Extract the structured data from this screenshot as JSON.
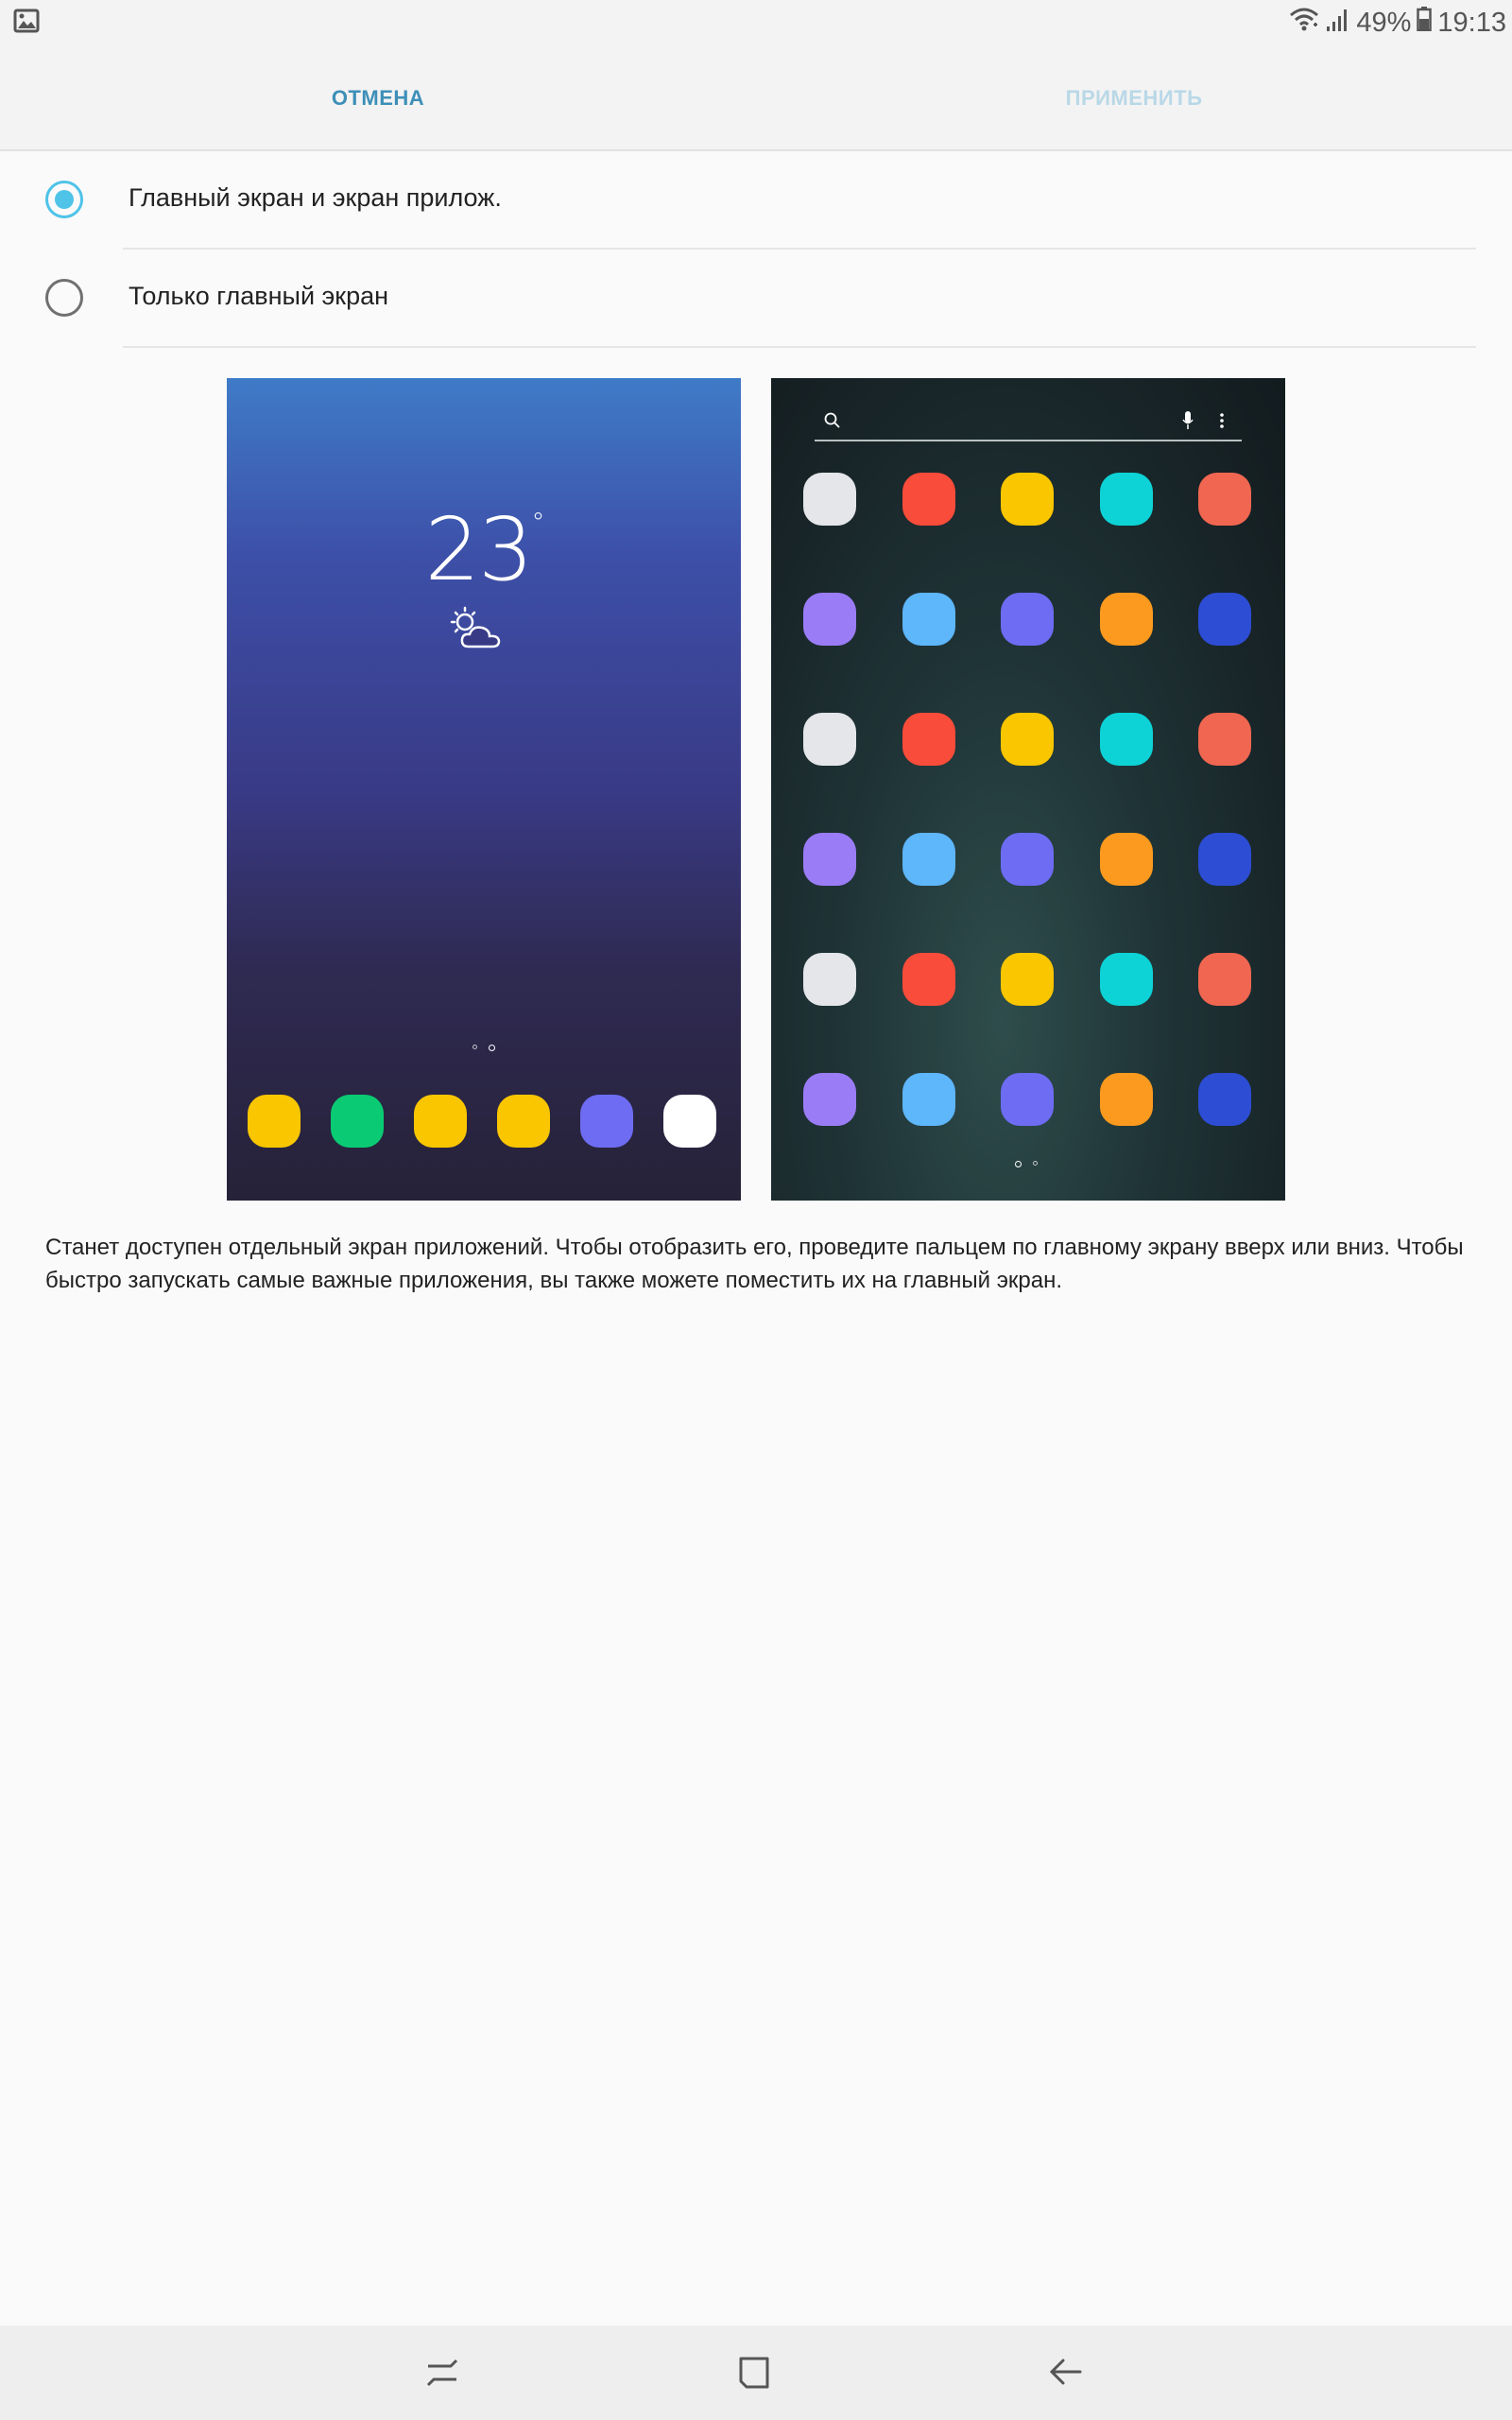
{
  "status_bar": {
    "left_icon": "gallery-notification-icon",
    "wifi_icon": "wifi-icon",
    "signal_icon": "signal-icon",
    "battery_percent": "49%",
    "battery_icon": "battery-icon",
    "time": "19:13"
  },
  "action_bar": {
    "cancel_label": "ОТМЕНА",
    "apply_label": "ПРИМЕНИТЬ"
  },
  "options": [
    {
      "label": "Главный экран и экран прилож.",
      "checked": true
    },
    {
      "label": "Только главный экран",
      "checked": false
    }
  ],
  "preview_home": {
    "temperature": "23",
    "degree": "°",
    "weather_icon": "partly-cloudy-icon",
    "dock_colors": [
      "#f9c600",
      "#0acb73",
      "#f9c600",
      "#f9c600",
      "#6e6cf2",
      "#ffffff"
    ]
  },
  "preview_apps": {
    "search_icon": "search-icon",
    "mic_icon": "mic-icon",
    "more_icon": "more-vertical-icon",
    "grid_colors": [
      [
        "#e4e6ea",
        "#f94c3a",
        "#f9c600",
        "#0dd3d6",
        "#f06650"
      ],
      [
        "#9b7cf7",
        "#5eb6fb",
        "#6e6cf2",
        "#fb9a1e",
        "#2d4dd4"
      ],
      [
        "#e4e6ea",
        "#f94c3a",
        "#f9c600",
        "#0dd3d6",
        "#f06650"
      ],
      [
        "#9b7cf7",
        "#5eb6fb",
        "#6e6cf2",
        "#fb9a1e",
        "#2d4dd4"
      ],
      [
        "#e4e6ea",
        "#f94c3a",
        "#f9c600",
        "#0dd3d6",
        "#f06650"
      ],
      [
        "#9b7cf7",
        "#5eb6fb",
        "#6e6cf2",
        "#fb9a1e",
        "#2d4dd4"
      ]
    ]
  },
  "description": "Станет доступен отдельный экран приложений. Чтобы отобразить его, проведите пальцем по главному экрану вверх или вниз. Чтобы быстро запускать самые важные приложения, вы также можете поместить их на главный экран.",
  "nav_bar": {
    "recents_icon": "recents-icon",
    "home_icon": "home-icon",
    "back_icon": "back-icon"
  },
  "colors": {
    "accent": "#4fc3e8",
    "action_enabled": "#3d8fb8",
    "action_disabled": "#b9d8e7"
  }
}
